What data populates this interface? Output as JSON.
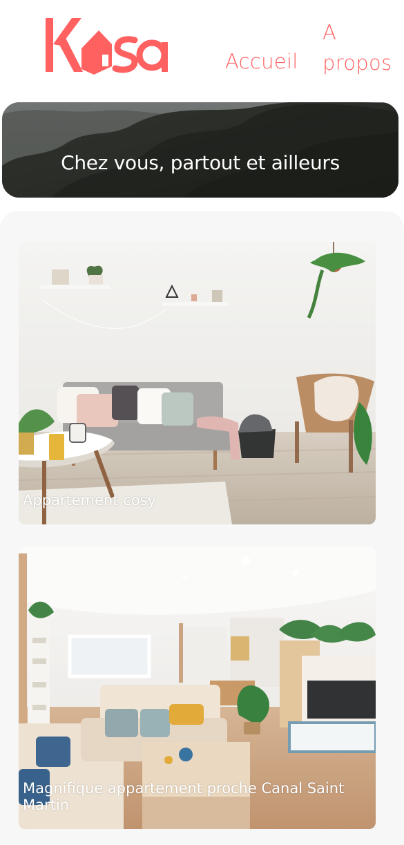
{
  "header": {
    "logo_text": "Kasa",
    "nav": [
      {
        "label": "Accueil"
      },
      {
        "label": "A propos"
      }
    ]
  },
  "banner": {
    "title": "Chez vous, partout et ailleurs"
  },
  "gallery": {
    "cards": [
      {
        "title": "Appartement cosy"
      },
      {
        "title": "Magnifique appartement proche Canal Saint Martin"
      }
    ]
  },
  "colors": {
    "brand": "#FF6060",
    "gallery_background": "#F7F7F7",
    "text_light": "#FFFFFF"
  },
  "icons": {
    "logo_house": "house-icon"
  }
}
